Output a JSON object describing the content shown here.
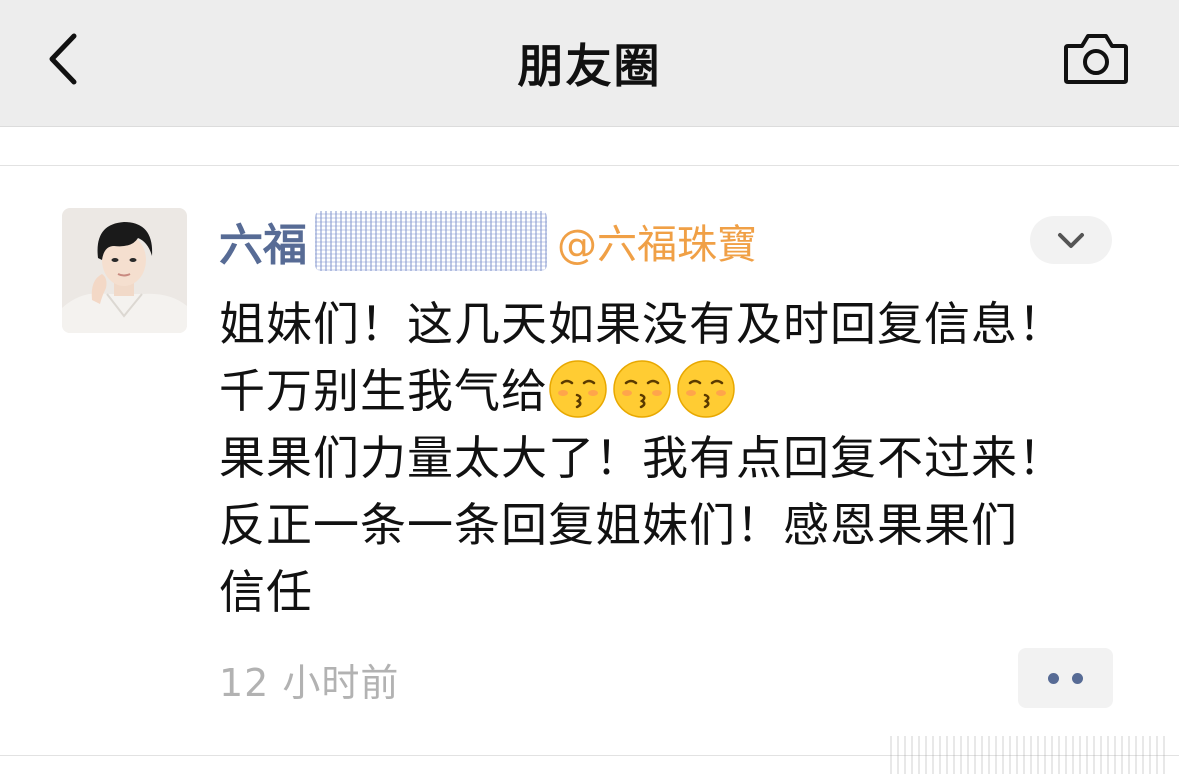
{
  "navbar": {
    "title": "朋友圈",
    "back_icon": "chevron-left-icon",
    "camera_icon": "camera-icon"
  },
  "post": {
    "author_name": "六福",
    "mention": "@六福珠寶",
    "body_lines": [
      "姐妹们！这几天如果没有及时回复信息！",
      "千万别生我气给",
      "果果们力量太大了！我有点回复不过来！",
      "反正一条一条回复姐妹们！感恩果果们",
      "信任"
    ],
    "emoji_icon": "kissing-face-emoji",
    "emoji_count_note": "3",
    "timestamp": "12 小时前",
    "more_icon": "more-dots-icon",
    "expand_icon": "chevron-down-icon"
  },
  "colors": {
    "navbar_bg": "#ededed",
    "author_name": "#576b95",
    "mention": "#f0a046",
    "timestamp": "#b2b2b2",
    "body_text": "#111111"
  }
}
